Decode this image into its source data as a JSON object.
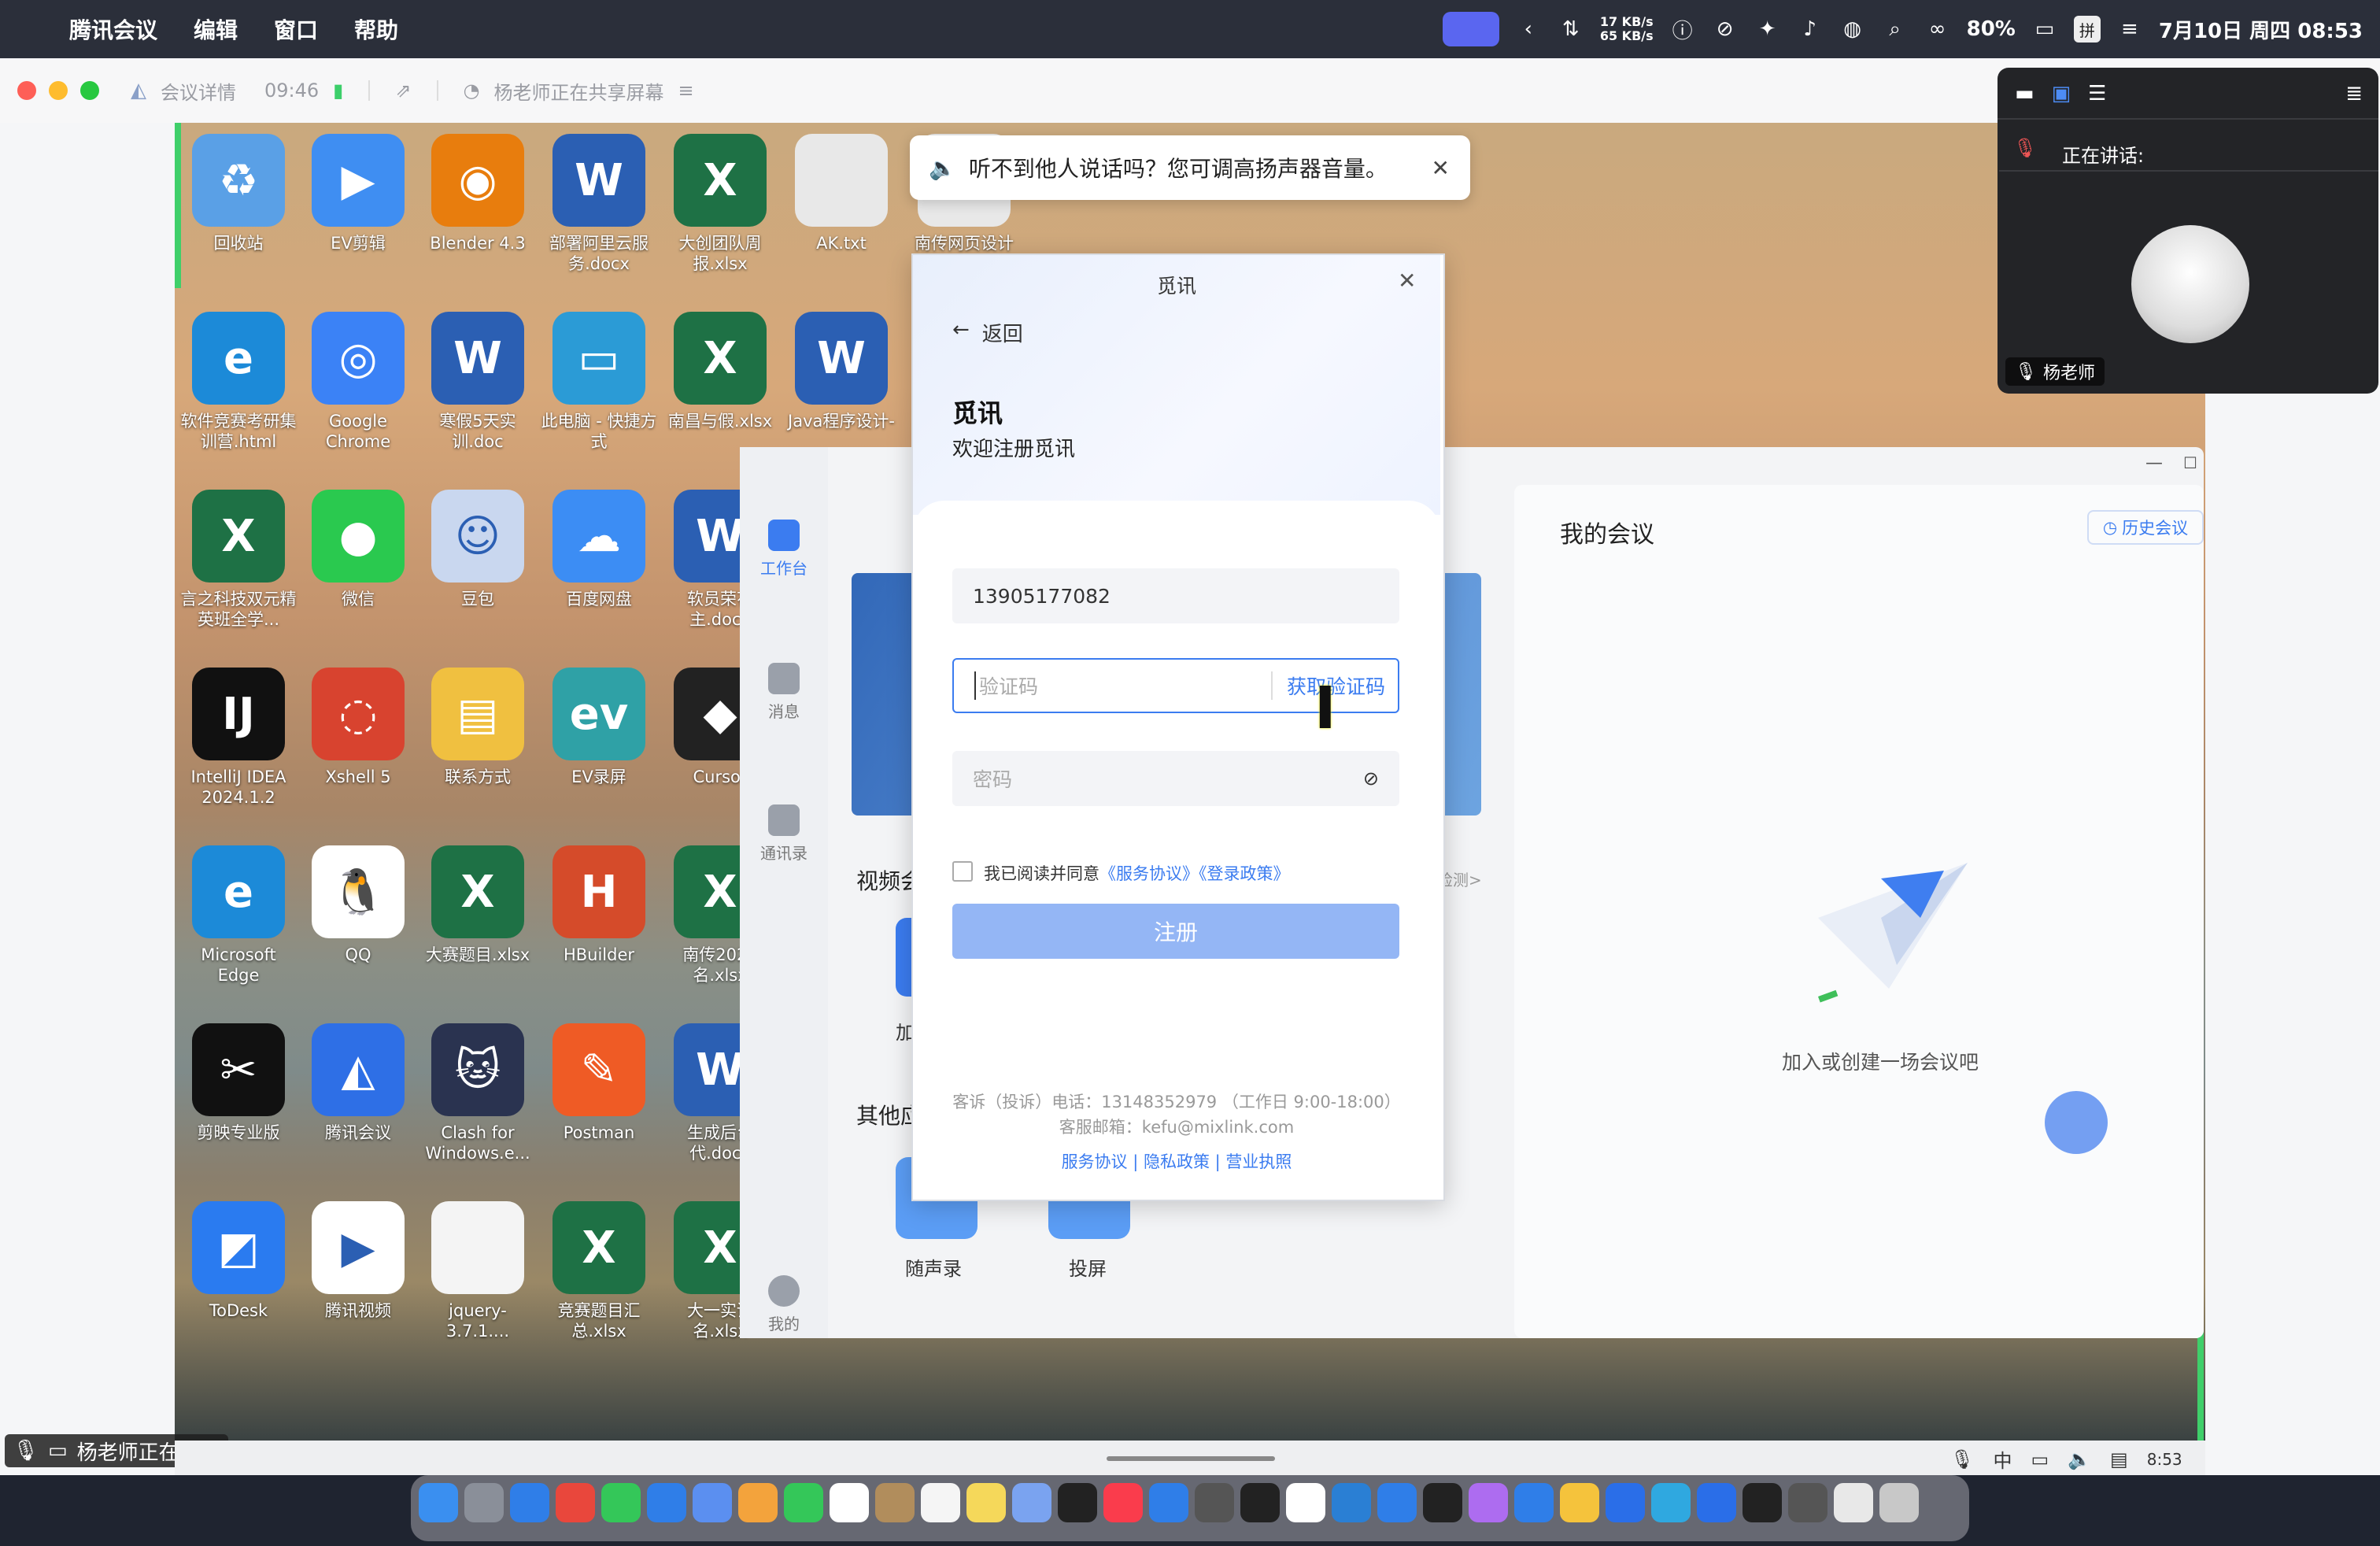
{
  "menubar": {
    "app": "腾讯会议",
    "menu_edit": "编辑",
    "menu_window": "窗口",
    "menu_help": "帮助",
    "net_up": "17 KB/s",
    "net_down": "65 KB/s",
    "battery": "80%",
    "datetime": "7月10日 周四  08:53"
  },
  "meeting_bar": {
    "details": "会议详情",
    "duration": "09:46",
    "sharing_status": "杨老师正在共享屏幕"
  },
  "toast": {
    "text": "听不到他人说话吗？您可调高扬声器音量。"
  },
  "speaker_panel": {
    "label": "正在讲话:",
    "name": "杨老师"
  },
  "bottom_status": {
    "text": "杨老师正在共享"
  },
  "desktop": {
    "icons": [
      {
        "label": "回收站",
        "color": "#5aa0e6",
        "glyph": "♻"
      },
      {
        "label": "EV剪辑",
        "color": "#3f8ef2",
        "glyph": "▶"
      },
      {
        "label": "Blender 4.3",
        "color": "#e87d0d",
        "glyph": "◉"
      },
      {
        "label": "部署阿里云服务.docx",
        "color": "#2b5fb3",
        "glyph": "W"
      },
      {
        "label": "大创团队周报.xlsx",
        "color": "#1e7145",
        "glyph": "X"
      },
      {
        "label": "AK.txt",
        "color": "#e8e8e8",
        "glyph": ""
      },
      {
        "label": "南传网页设计大...",
        "color": "#e8e8e8",
        "glyph": ""
      },
      {
        "label": "软件竞赛考研集训营.html",
        "color": "#1c8ad8",
        "glyph": "e"
      },
      {
        "label": "Google Chrome",
        "color": "#3b82f6",
        "glyph": "◎"
      },
      {
        "label": "寒假5天实训.doc",
        "color": "#2b5fb3",
        "glyph": "W"
      },
      {
        "label": "此电脑 - 快捷方式",
        "color": "#2b9bd6",
        "glyph": "▭"
      },
      {
        "label": "南昌与假.xlsx",
        "color": "#1e7145",
        "glyph": "X"
      },
      {
        "label": "Java程序设计-",
        "color": "#2b5fb3",
        "glyph": "W"
      },
      {
        "label": "言之科技双元精英班全学...",
        "color": "#1e7145",
        "glyph": "X"
      },
      {
        "label": "微信",
        "color": "#2ac94f",
        "glyph": "●"
      },
      {
        "label": "豆包",
        "color": "#c9d7ef",
        "glyph": "☺"
      },
      {
        "label": "百度网盘",
        "color": "#3c8df4",
        "glyph": "☁"
      },
      {
        "label": "软员荣花主.docx",
        "color": "#2b5fb3",
        "glyph": "W"
      },
      {
        "label": "IntelliJ IDEA 2024.1.2",
        "color": "#111111",
        "glyph": "IJ"
      },
      {
        "label": "Xshell 5",
        "color": "#d8432f",
        "glyph": "◌"
      },
      {
        "label": "联系方式",
        "color": "#f0c040",
        "glyph": "▤"
      },
      {
        "label": "EV录屏",
        "color": "#2fa1a6",
        "glyph": "ev"
      },
      {
        "label": "Cursor",
        "color": "#222222",
        "glyph": "◆"
      },
      {
        "label": "Microsoft Edge",
        "color": "#1c8ad8",
        "glyph": "e"
      },
      {
        "label": "QQ",
        "color": "#ffffff",
        "glyph": "🐧"
      },
      {
        "label": "大赛题目.xlsx",
        "color": "#1e7145",
        "glyph": "X"
      },
      {
        "label": "HBuilder",
        "color": "#d54b2a",
        "glyph": "H"
      },
      {
        "label": "南传2024名.xlsx",
        "color": "#1e7145",
        "glyph": "X"
      },
      {
        "label": "剪映专业版",
        "color": "#111111",
        "glyph": "✂"
      },
      {
        "label": "腾讯会议",
        "color": "#2e6fe6",
        "glyph": "◭"
      },
      {
        "label": "Clash for Windows.e...",
        "color": "#2a3350",
        "glyph": "🐱"
      },
      {
        "label": "Postman",
        "color": "#ef5b25",
        "glyph": "✎"
      },
      {
        "label": "生成后台代.docx",
        "color": "#2b5fb3",
        "glyph": "W"
      },
      {
        "label": "ToDesk",
        "color": "#2a7bf0",
        "glyph": "◩"
      },
      {
        "label": "腾讯视频",
        "color": "#ffffff",
        "glyph": "▶"
      },
      {
        "label": "jquery-3.7.1....",
        "color": "#f4f4f4",
        "glyph": ""
      },
      {
        "label": "竞赛题目汇总.xlsx",
        "color": "#1e7145",
        "glyph": "X"
      },
      {
        "label": "大一实训名.xlsx",
        "color": "#1e7145",
        "glyph": "X"
      }
    ]
  },
  "app": {
    "side_workbench": "工作台",
    "side_messages": "消息",
    "side_contacts": "通讯录",
    "side_me": "我的",
    "video_label": "视频会",
    "other_label": "其他应",
    "join_label": "加",
    "recorder": "随声录",
    "cast": "投屏",
    "detect": "检测>",
    "my_meetings": "我的会议",
    "history": "历史会议",
    "empty_hint": "加入或创建一场会议吧"
  },
  "dialog": {
    "title": "觅讯",
    "back": "返回",
    "brand": "觅讯",
    "welcome": "欢迎注册觅讯",
    "phone_value": "13905177082",
    "code_placeholder": "验证码",
    "get_code": "获取验证码",
    "password_placeholder": "密码",
    "agree_prefix": "我已阅读并同意",
    "agree_service": "《服务协议》",
    "agree_login": "《登录政策》",
    "register": "注册",
    "complaint": "客诉（投诉）电话：13148352979 （工作日 9:00-18:00）",
    "email": "客服邮箱：kefu@mixlink.com",
    "footer_links": "服务协议 | 隐私政策 | 营业执照"
  },
  "taskbar": {
    "lang": "中",
    "time": "8:53"
  }
}
